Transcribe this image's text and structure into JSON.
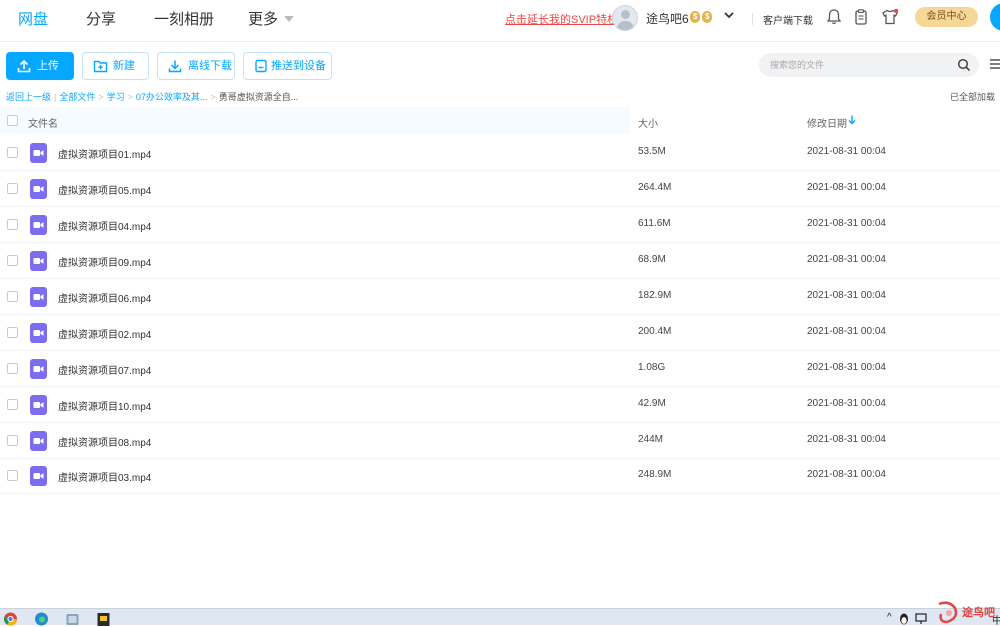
{
  "nav": {
    "items": [
      {
        "label": "网盘",
        "active": true
      },
      {
        "label": "分享",
        "active": false
      },
      {
        "label": "一刻相册",
        "active": false
      },
      {
        "label": "更多",
        "active": false
      }
    ]
  },
  "header": {
    "svip_promo": "点击延长我的SVIP特权",
    "username": "途鸟吧6",
    "badge_1": "$",
    "badge_2": "$",
    "client_download": "客户端下载",
    "member_center": "会员中心"
  },
  "toolbar": {
    "upload": "上传",
    "new": "新建",
    "offline_download": "离线下载",
    "push_to_device": "推送到设备",
    "search_placeholder": "搜索您的文件"
  },
  "breadcrumb": {
    "back": "返回上一级",
    "items": [
      "全部文件",
      "学习",
      "07办公效率及其..."
    ],
    "current": "勇哥虚拟资源全自...",
    "loaded_status": "已全部加载"
  },
  "table": {
    "columns": {
      "name": "文件名",
      "size": "大小",
      "modified": "修改日期"
    },
    "rows": [
      {
        "name": "虚拟资源项目01.mp4",
        "size": "53.5M",
        "date": "2021-08-31 00:04"
      },
      {
        "name": "虚拟资源项目05.mp4",
        "size": "264.4M",
        "date": "2021-08-31 00:04"
      },
      {
        "name": "虚拟资源项目04.mp4",
        "size": "611.6M",
        "date": "2021-08-31 00:04"
      },
      {
        "name": "虚拟资源项目09.mp4",
        "size": "68.9M",
        "date": "2021-08-31 00:04"
      },
      {
        "name": "虚拟资源项目06.mp4",
        "size": "182.9M",
        "date": "2021-08-31 00:04"
      },
      {
        "name": "虚拟资源项目02.mp4",
        "size": "200.4M",
        "date": "2021-08-31 00:04"
      },
      {
        "name": "虚拟资源项目07.mp4",
        "size": "1.08G",
        "date": "2021-08-31 00:04"
      },
      {
        "name": "虚拟资源项目10.mp4",
        "size": "42.9M",
        "date": "2021-08-31 00:04"
      },
      {
        "name": "虚拟资源项目08.mp4",
        "size": "244M",
        "date": "2021-08-31 00:04"
      },
      {
        "name": "虚拟资源项目03.mp4",
        "size": "248.9M",
        "date": "2021-08-31 00:04"
      }
    ]
  },
  "taskbar": {
    "tray_text": "中"
  },
  "watermark": "途鸟吧",
  "colors": {
    "accent": "#06a7ff",
    "promo_red": "#f04646",
    "member_gold": "#f5d798",
    "video_icon": "#7b6cf0"
  }
}
